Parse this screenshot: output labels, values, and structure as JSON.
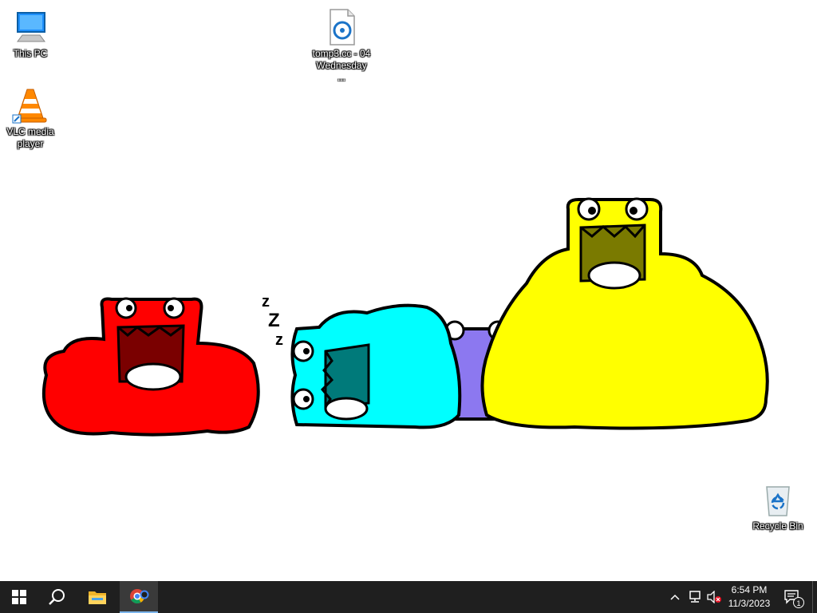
{
  "desktop": {
    "icons": [
      {
        "label": "This PC",
        "icon": "computer-icon"
      },
      {
        "label": "tomp3.cc - 04 Wednesday ...",
        "icon": "audio-file-icon"
      },
      {
        "label": "VLC media player",
        "icon": "vlc-cone-icon"
      },
      {
        "label": "Recycle Bin",
        "icon": "recycle-bin-icon"
      }
    ],
    "wallpaper": {
      "colors": {
        "red": "#ff0000",
        "cyan": "#00ffff",
        "purple": "#8c78f0",
        "yellow": "#ffff00"
      },
      "sleep_text": "Z Z Z"
    }
  },
  "taskbar": {
    "background": "#1f1f1f",
    "buttons": [
      {
        "name": "start",
        "icon": "windows-logo-icon"
      },
      {
        "name": "search",
        "icon": "search-icon"
      },
      {
        "name": "file-explorer",
        "icon": "folder-icon"
      },
      {
        "name": "chrome",
        "icon": "chrome-icon"
      }
    ],
    "tray": {
      "icons": [
        "chevron-up-icon",
        "network-icon",
        "volume-muted-icon"
      ],
      "time": "6:54 PM",
      "date": "11/3/2023",
      "notification_count": "1"
    }
  }
}
